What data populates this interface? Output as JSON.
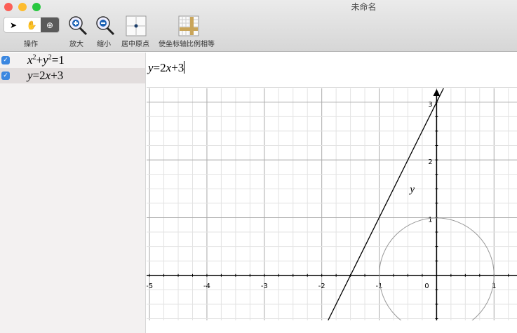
{
  "window": {
    "title": "未命名"
  },
  "toolbar": {
    "mode_label": "操作",
    "zoom_in": "放大",
    "zoom_out": "缩小",
    "center_origin": "居中原点",
    "equal_axes": "使坐标轴比例相等",
    "modes": [
      "arrow-icon",
      "hand-icon",
      "magnifier-icon"
    ],
    "active_mode": "magnifier-icon"
  },
  "equations": [
    {
      "checked": true,
      "selected": false,
      "lhs_x": "x",
      "sup1": "2",
      "plus": "+",
      "lhs_y": "y",
      "sup2": "2",
      "rest": "=1"
    },
    {
      "checked": true,
      "selected": true,
      "a": "y",
      "b": "=2",
      "c": "x",
      "d": "+3"
    }
  ],
  "editor": {
    "a": "y",
    "b": "=2",
    "c": "x",
    "d": "+3"
  },
  "graph": {
    "x_ticks": [
      "-5",
      "-4",
      "-3",
      "-2",
      "-1",
      "0",
      "1"
    ],
    "y_ticks": [
      "1",
      "2",
      "3"
    ],
    "y_axis_label": "y",
    "xlim": [
      -5.05,
      1.4
    ],
    "ylim": [
      -0.78,
      3.24
    ],
    "curves": [
      {
        "type": "circle",
        "r": 1,
        "color": "#999999"
      },
      {
        "type": "line",
        "slope": 2,
        "intercept": 3,
        "color": "#000000"
      }
    ]
  }
}
